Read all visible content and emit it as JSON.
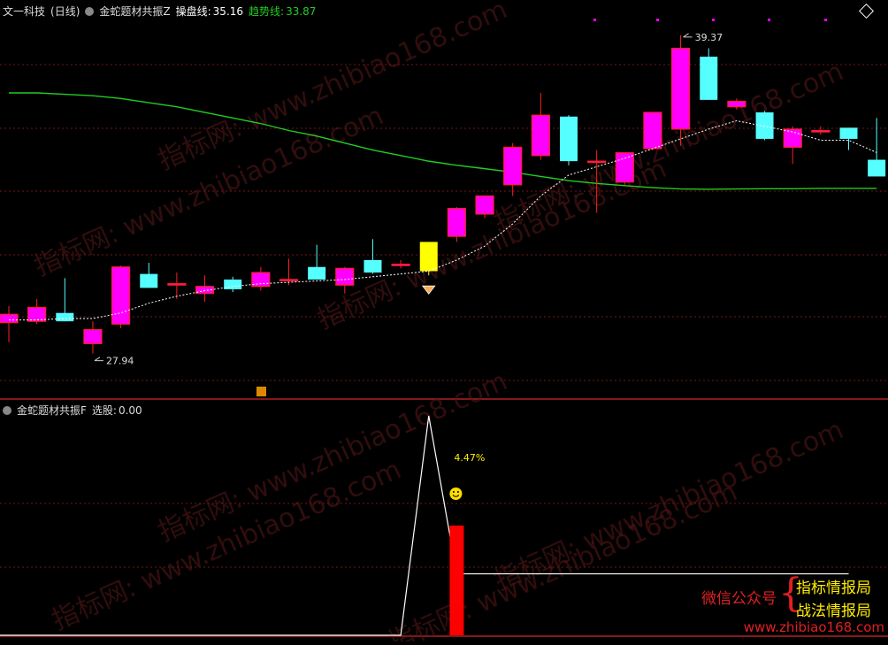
{
  "header": {
    "stock": "文一科技",
    "period": "(日线)",
    "indicator": "金蛇题材共振Z",
    "line1_label": "操盘线:",
    "line1_value": "35.16",
    "line2_label": "趋势线:",
    "line2_value": "33.87"
  },
  "sub_header": {
    "indicator": "金蛇题材共振F",
    "label": "选股:",
    "value": "0.00"
  },
  "colors": {
    "up": "#ff00ff",
    "down": "#55ffff",
    "signal": "#ffff00",
    "ma": "#ffffff",
    "trend": "#22cc22",
    "grid": "#7a1515",
    "bar": "#ff0000",
    "brand_red": "#e02020",
    "brand_yellow": "#ffee00"
  },
  "chart_data": {
    "type": "candlestick",
    "y_range": [
      26.5,
      40.0
    ],
    "price_labels": {
      "high": "39.37",
      "low": "27.94"
    },
    "candles": [
      {
        "o": 29.35,
        "h": 29.65,
        "l": 28.35,
        "c": 29.05,
        "color": "up"
      },
      {
        "o": 29.1,
        "h": 29.9,
        "l": 29.0,
        "c": 29.6,
        "color": "up"
      },
      {
        "o": 29.4,
        "h": 30.65,
        "l": 29.1,
        "c": 29.1,
        "color": "down"
      },
      {
        "o": 28.3,
        "h": 29.1,
        "l": 27.94,
        "c": 28.8,
        "color": "up"
      },
      {
        "o": 29.0,
        "h": 31.1,
        "l": 28.85,
        "c": 31.05,
        "color": "up"
      },
      {
        "o": 30.8,
        "h": 31.2,
        "l": 30.3,
        "c": 30.3,
        "color": "down"
      },
      {
        "o": 30.45,
        "h": 30.85,
        "l": 29.9,
        "c": 30.45,
        "color": "up"
      },
      {
        "o": 30.1,
        "h": 30.75,
        "l": 29.8,
        "c": 30.35,
        "color": "up"
      },
      {
        "o": 30.6,
        "h": 30.7,
        "l": 30.15,
        "c": 30.25,
        "color": "down"
      },
      {
        "o": 30.35,
        "h": 31.05,
        "l": 30.2,
        "c": 30.85,
        "color": "up"
      },
      {
        "o": 30.6,
        "h": 31.35,
        "l": 30.4,
        "c": 30.6,
        "color": "up"
      },
      {
        "o": 31.05,
        "h": 31.85,
        "l": 30.6,
        "c": 30.6,
        "color": "down"
      },
      {
        "o": 30.4,
        "h": 31.05,
        "l": 30.1,
        "c": 31.0,
        "color": "up"
      },
      {
        "o": 31.3,
        "h": 32.05,
        "l": 30.8,
        "c": 30.85,
        "color": "down"
      },
      {
        "o": 31.1,
        "h": 31.3,
        "l": 31.0,
        "c": 31.15,
        "color": "up"
      },
      {
        "o": 30.9,
        "h": 31.95,
        "l": 30.75,
        "c": 31.95,
        "color": "signal"
      },
      {
        "o": 32.15,
        "h": 33.2,
        "l": 31.95,
        "c": 33.15,
        "color": "up"
      },
      {
        "o": 32.95,
        "h": 33.55,
        "l": 32.8,
        "c": 33.6,
        "color": "up"
      },
      {
        "o": 34.0,
        "h": 35.5,
        "l": 33.6,
        "c": 35.35,
        "color": "up"
      },
      {
        "o": 35.05,
        "h": 37.3,
        "l": 34.9,
        "c": 36.5,
        "color": "up"
      },
      {
        "o": 36.45,
        "h": 36.5,
        "l": 34.7,
        "c": 34.85,
        "color": "down"
      },
      {
        "o": 34.85,
        "h": 35.25,
        "l": 33.0,
        "c": 34.85,
        "color": "up"
      },
      {
        "o": 34.1,
        "h": 35.15,
        "l": 34.0,
        "c": 35.15,
        "color": "up"
      },
      {
        "o": 35.3,
        "h": 36.5,
        "l": 35.25,
        "c": 36.6,
        "color": "up"
      },
      {
        "o": 36.0,
        "h": 39.37,
        "l": 35.4,
        "c": 38.9,
        "color": "up"
      },
      {
        "o": 38.6,
        "h": 38.9,
        "l": 37.05,
        "c": 37.05,
        "color": "down"
      },
      {
        "o": 36.8,
        "h": 37.1,
        "l": 36.7,
        "c": 37.0,
        "color": "up"
      },
      {
        "o": 36.6,
        "h": 36.65,
        "l": 35.6,
        "c": 35.65,
        "color": "down"
      },
      {
        "o": 35.35,
        "h": 36.1,
        "l": 34.75,
        "c": 36.0,
        "color": "up"
      },
      {
        "o": 35.9,
        "h": 36.1,
        "l": 35.8,
        "c": 35.95,
        "color": "up"
      },
      {
        "o": 36.05,
        "h": 36.05,
        "l": 35.25,
        "c": 35.65,
        "color": "down"
      },
      {
        "o": 34.9,
        "h": 36.4,
        "l": 34.8,
        "c": 34.3,
        "color": "down"
      }
    ],
    "ma_line": [
      29.15,
      29.15,
      29.2,
      29.2,
      29.4,
      29.75,
      30.0,
      30.2,
      30.35,
      30.45,
      30.5,
      30.55,
      30.6,
      30.7,
      30.8,
      30.9,
      31.3,
      31.8,
      32.6,
      33.6,
      34.35,
      34.65,
      34.95,
      35.3,
      35.65,
      36.0,
      36.3,
      36.1,
      35.9,
      35.6,
      35.6,
      35.16
    ],
    "trend_line": [
      37.3,
      37.3,
      37.25,
      37.2,
      37.1,
      36.95,
      36.8,
      36.6,
      36.4,
      36.2,
      35.95,
      35.75,
      35.5,
      35.25,
      35.05,
      34.85,
      34.7,
      34.58,
      34.45,
      34.3,
      34.15,
      34.05,
      33.97,
      33.9,
      33.85,
      33.84,
      33.85,
      33.86,
      33.86,
      33.87,
      33.87,
      33.87
    ],
    "signal_marker_index": 15,
    "sub_chart": {
      "y_range": [
        0,
        100
      ],
      "line": [
        0,
        0,
        0,
        0,
        0,
        0,
        0,
        0,
        0,
        0,
        0,
        0,
        0,
        0,
        0,
        0,
        100,
        28,
        28,
        28,
        28,
        28,
        28,
        28,
        28,
        28,
        28,
        28,
        28,
        28,
        28,
        28
      ],
      "bar_index": 16,
      "bar_value": 50,
      "annotation": "4.47%"
    }
  },
  "watermark": {
    "text": "指标网: www.zhibiao168.com",
    "corner_url": "www.zhibiao168.com"
  },
  "brand": {
    "left": "微信公众号",
    "right_top": "指标情报局",
    "right_bottom": "战法情报局"
  }
}
